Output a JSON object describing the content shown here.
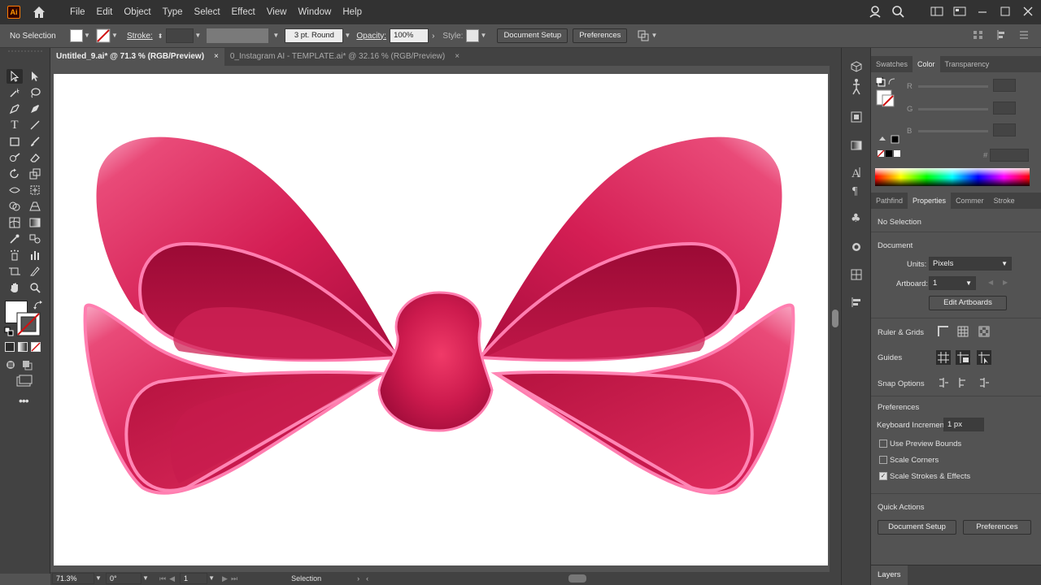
{
  "app": {
    "logo": "Ai"
  },
  "menu": [
    "File",
    "Edit",
    "Object",
    "Type",
    "Select",
    "Effect",
    "View",
    "Window",
    "Help"
  ],
  "control": {
    "selection": "No Selection",
    "stroke_label": "Stroke:",
    "brush": "3 pt. Round",
    "opacity_label": "Opacity:",
    "opacity": "100%",
    "style_label": "Style:",
    "document_setup": "Document Setup",
    "preferences": "Preferences"
  },
  "tabs": [
    {
      "label": "Untitled_9.ai* @ 71.3 % (RGB/Preview)",
      "close": "×"
    },
    {
      "label": "0_Instagram AI - TEMPLATE.ai* @ 32.16 % (RGB/Preview)",
      "close": "×"
    }
  ],
  "status": {
    "zoom": "71.3%",
    "angle": "0°",
    "artboard": "1",
    "tool": "Selection"
  },
  "color_panel": {
    "tabs": [
      "Swatches",
      "Color",
      "Transparency"
    ],
    "r": "R",
    "g": "G",
    "b": "B",
    "hash": "#"
  },
  "properties_panel": {
    "tabs": [
      "Pathfind",
      "Properties",
      "Commer",
      "Stroke"
    ],
    "selection": "No Selection",
    "document_heading": "Document",
    "units_label": "Units:",
    "units_value": "Pixels",
    "artboard_label": "Artboard:",
    "artboard_value": "1",
    "edit_artboards": "Edit Artboards",
    "ruler_grids": "Ruler & Grids",
    "guides": "Guides",
    "snap_options": "Snap Options",
    "preferences_heading": "Preferences",
    "keyboard_increment_label": "Keyboard Increment:",
    "keyboard_increment_value": "1 px",
    "use_preview_bounds": "Use Preview Bounds",
    "scale_corners": "Scale Corners",
    "scale_strokes": "Scale Strokes & Effects",
    "quick_actions": "Quick Actions",
    "qa_document_setup": "Document Setup",
    "qa_preferences": "Preferences"
  },
  "layers_panel": {
    "title": "Layers"
  },
  "colors": {
    "accent": "#e8345f",
    "ui_dark": "#323232",
    "ui_mid": "#535353"
  }
}
